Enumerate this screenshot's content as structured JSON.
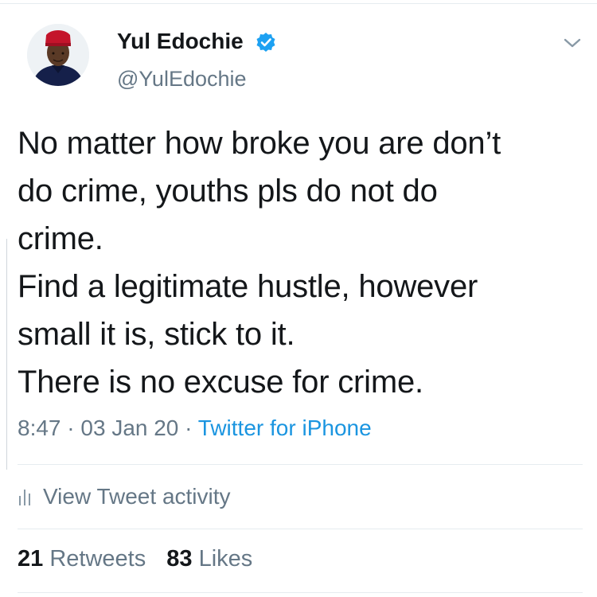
{
  "user": {
    "display_name": "Yul Edochie",
    "handle": "@YulEdochie",
    "verified": true
  },
  "tweet": {
    "lines": [
      "No matter how broke you are don’t",
      "do crime, youths pls do not do",
      "crime.",
      "Find a legitimate hustle, however",
      "small it is, stick to it.",
      "There is no excuse for crime."
    ],
    "time": "8:47",
    "date": "03 Jan 20",
    "separator": "·",
    "source": "Twitter for iPhone"
  },
  "activity": {
    "label": "View Tweet activity",
    "icon": "bar-chart-icon"
  },
  "stats": {
    "retweets_count": "21",
    "retweets_label": "Retweets",
    "likes_count": "83",
    "likes_label": "Likes"
  },
  "colors": {
    "text": "#14171a",
    "secondary": "#657786",
    "link": "#1b95e0",
    "verified": "#1da1f2",
    "divider": "#e6ecf0"
  }
}
